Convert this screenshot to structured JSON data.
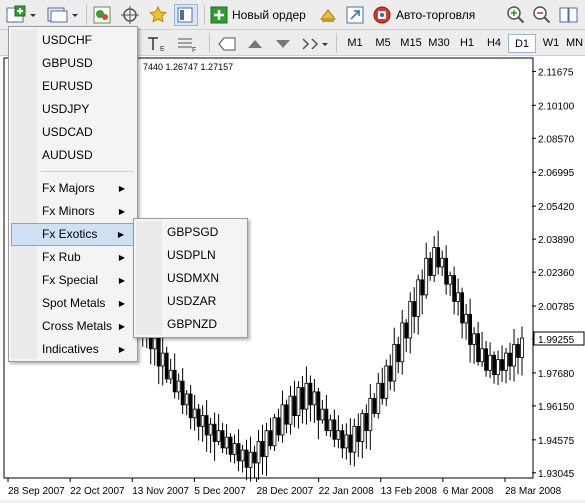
{
  "toolbar": {
    "new_order_label": "Новый ордер",
    "autotrading_label": "Авто-торговля",
    "timeframes": [
      "M1",
      "M5",
      "M15",
      "M30",
      "H1",
      "H4",
      "D1",
      "W1",
      "MN"
    ],
    "active_timeframe": "D1"
  },
  "chart_info": "7440 1.26747 1.27157",
  "chart_data": {
    "type": "candlestick",
    "price_axis_labels": [
      "2.11675",
      "2.10100",
      "2.08570",
      "2.06995",
      "2.05420",
      "2.03890",
      "2.02360",
      "2.00785",
      "1.99255",
      "1.97680",
      "1.96150",
      "1.94575",
      "1.93045"
    ],
    "current_price_label": "1.99255",
    "date_axis_labels": [
      "28 Sep 2007",
      "22 Oct 2007",
      "13 Nov 2007",
      "5 Dec 2007",
      "28 Dec 2007",
      "22 Jan 2008",
      "13 Feb 2008",
      "6 Mar 2008",
      "28 Mar 2008"
    ],
    "ylim": [
      1.9285,
      2.1225
    ],
    "closes": [
      2.012,
      2.035,
      2.019,
      2.04,
      2.028,
      2.046,
      2.037,
      2.05,
      2.043,
      2.058,
      2.049,
      2.064,
      2.055,
      2.07,
      2.061,
      2.075,
      2.066,
      2.072,
      2.058,
      2.066,
      2.05,
      2.057,
      2.042,
      2.049,
      2.035,
      2.041,
      2.028,
      2.032,
      2.019,
      2.024,
      2.01,
      2.014,
      2.0,
      1.995,
      2.001,
      1.988,
      1.993,
      1.98,
      1.986,
      1.974,
      1.978,
      1.968,
      1.973,
      1.962,
      1.967,
      1.956,
      1.96,
      1.952,
      1.957,
      1.948,
      1.953,
      1.945,
      1.95,
      1.942,
      1.947,
      1.939,
      1.944,
      1.936,
      1.941,
      1.933,
      1.94,
      1.935,
      1.945,
      1.938,
      1.95,
      1.943,
      1.956,
      1.948,
      1.962,
      1.953,
      1.966,
      1.957,
      1.97,
      1.96,
      1.972,
      1.962,
      1.968,
      1.955,
      1.96,
      1.95,
      1.955,
      1.946,
      1.95,
      1.942,
      1.948,
      1.94,
      1.952,
      1.945,
      1.958,
      1.95,
      1.965,
      1.958,
      1.972,
      1.965,
      1.98,
      1.973,
      1.99,
      1.982,
      2.0,
      1.993,
      2.01,
      2.003,
      2.02,
      2.013,
      2.03,
      2.022,
      2.035,
      2.026,
      2.03,
      2.018,
      2.022,
      2.01,
      2.014,
      2.0,
      2.004,
      1.99,
      1.995,
      1.982,
      1.988,
      1.978,
      1.985,
      1.976,
      1.983,
      1.978,
      1.986,
      1.98,
      1.99,
      1.984,
      1.993
    ]
  },
  "menu": {
    "symbols": [
      "USDCHF",
      "GBPUSD",
      "EURUSD",
      "USDJPY",
      "USDCAD",
      "AUDUSD"
    ],
    "groups": [
      "Fx Majors",
      "Fx Minors",
      "Fx Exotics",
      "Fx Rub",
      "Fx Special",
      "Spot Metals",
      "Cross Metals",
      "Indicatives"
    ],
    "highlighted_group": "Fx Exotics"
  },
  "submenu": {
    "items": [
      "GBPSGD",
      "USDPLN",
      "USDMXN",
      "USDZAR",
      "GBPNZD"
    ]
  },
  "colors": {
    "accent": "#2f8f2f",
    "menu_highlight": "#cfe0f5",
    "candle": "#000000"
  }
}
